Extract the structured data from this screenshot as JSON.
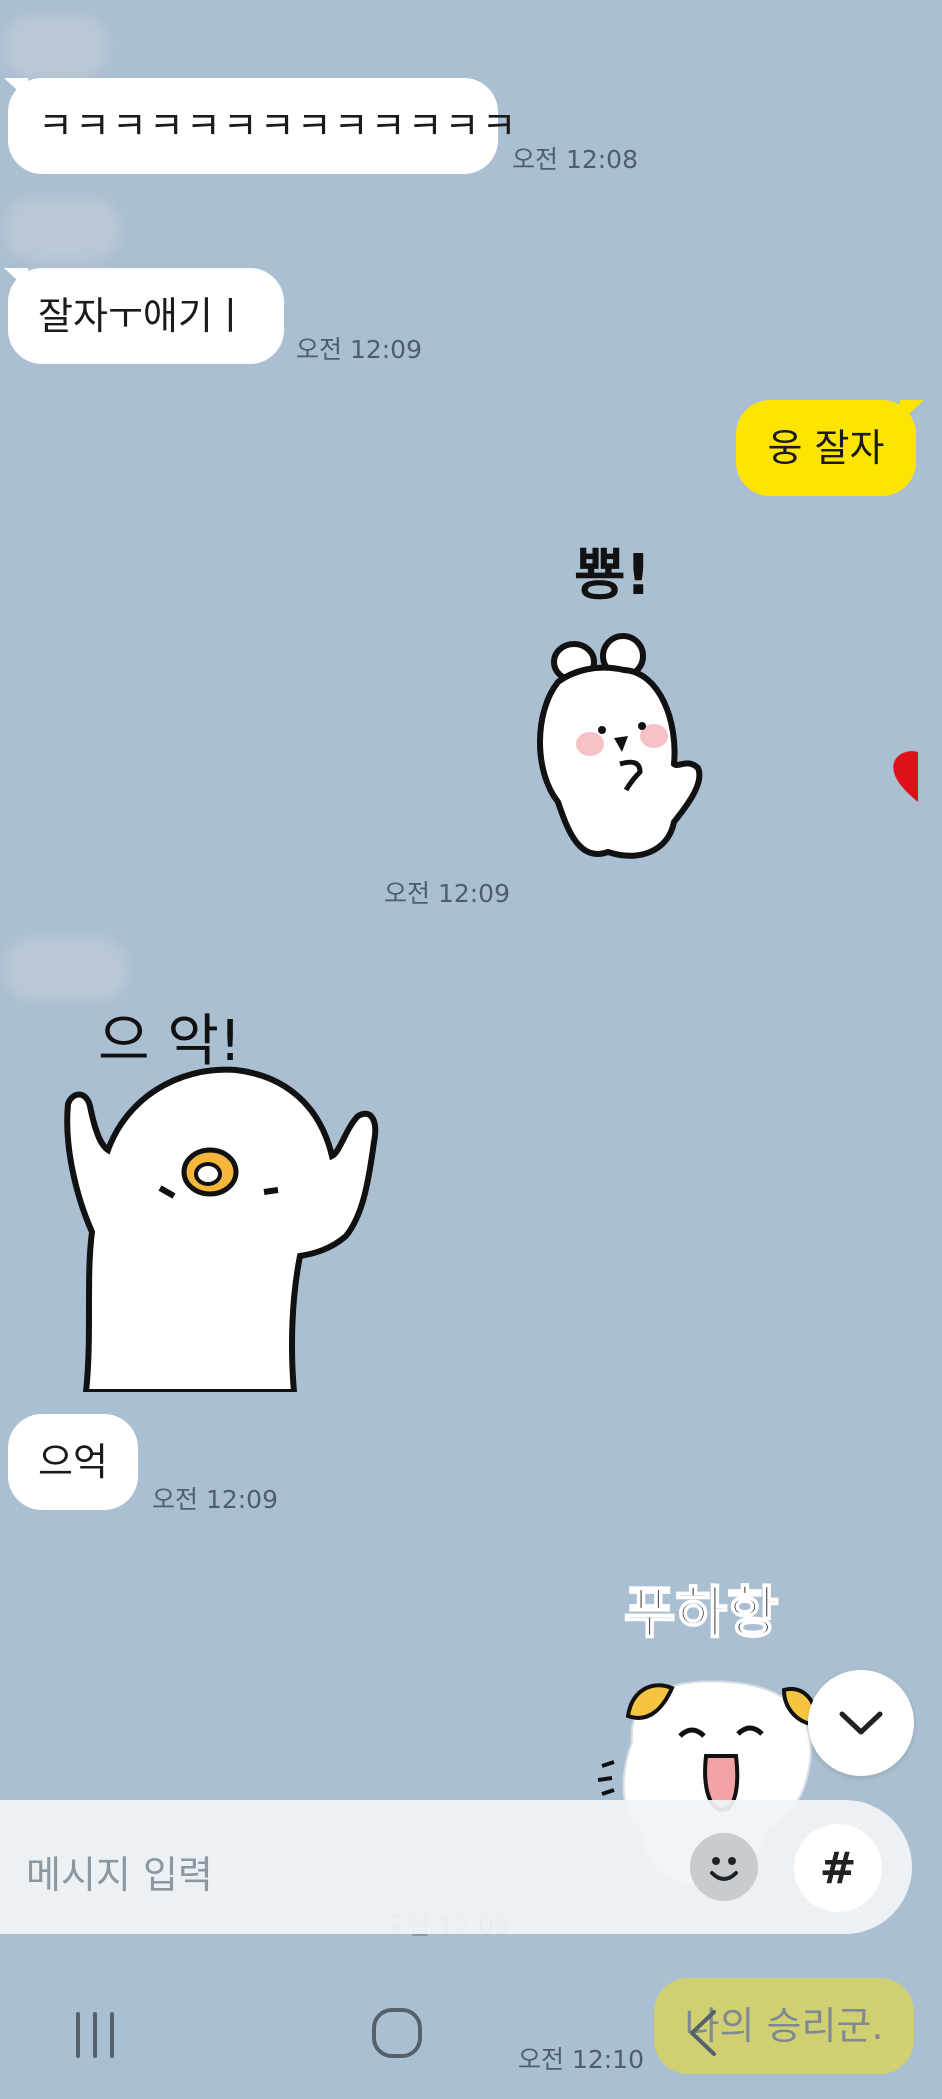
{
  "messages": [
    {
      "text": "ㅋㅋㅋㅋㅋㅋㅋㅋㅋㅋㅋㅋㅋ",
      "time": "오전 12:08"
    },
    {
      "text": "잘자ㅜ애기ㅣ",
      "time": "오전 12:09"
    },
    {
      "text": "웅 잘자"
    },
    {
      "sticker_text": "뿅!",
      "time": "오전 12:09"
    },
    {
      "sticker_text": "으 악!"
    },
    {
      "text": "으억",
      "time": "오전 12:09"
    },
    {
      "sticker_text": "푸하항",
      "time": "오전 12:09"
    },
    {
      "text": "나의 승리군.",
      "time": "오전 12:10"
    }
  ],
  "input": {
    "placeholder": "메시지 입력",
    "hash_label": "#"
  },
  "icons": {
    "emoji": "smiley-face-icon",
    "scroll": "chevron-down-icon",
    "nav_recent": "recent-apps-icon",
    "nav_home": "home-icon",
    "nav_back": "back-icon",
    "heart": "heart-icon"
  },
  "colors": {
    "background": "#abbfd2",
    "incoming_bubble": "#ffffff",
    "outgoing_bubble": "#fee500"
  }
}
